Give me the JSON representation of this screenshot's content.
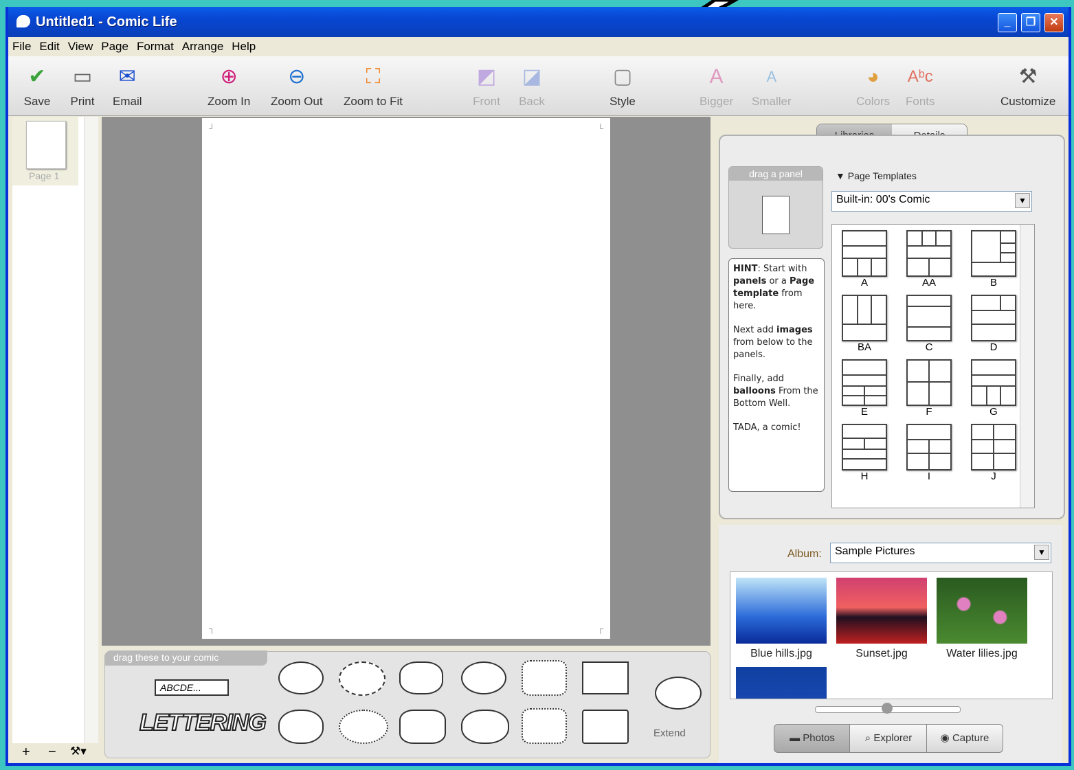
{
  "window": {
    "title": "Untitled1 - Comic Life",
    "controls": [
      "_",
      "❐",
      "✕"
    ]
  },
  "menu": [
    "File",
    "Edit",
    "View",
    "Page",
    "Format",
    "Arrange",
    "Help"
  ],
  "toolbar": {
    "save": "Save",
    "print": "Print",
    "email": "Email",
    "zoom_in": "Zoom In",
    "zoom_out": "Zoom Out",
    "zoom_fit": "Zoom to Fit",
    "front": "Front",
    "back": "Back",
    "style": "Style",
    "bigger": "Bigger",
    "smaller": "Smaller",
    "colors": "Colors",
    "fonts": "Fonts",
    "customize": "Customize"
  },
  "pages": {
    "page1_label": "Page 1"
  },
  "bottom_controls": {
    "add": "+",
    "remove": "−",
    "tools": "⚒▾"
  },
  "well": {
    "tab_label": "drag these to your comic",
    "abc": "ABCDE...",
    "lettering": "LETTERING",
    "extend": "Extend"
  },
  "library": {
    "tab_libraries": "Libraries",
    "tab_details": "Details",
    "drag_panel": "drag a panel",
    "page_templates_header": "Page Templates",
    "template_set": "Built-in: 00's Comic",
    "templates": [
      "A",
      "AA",
      "B",
      "BA",
      "C",
      "D",
      "E",
      "F",
      "G",
      "H",
      "I",
      "J"
    ]
  },
  "hint": {
    "p1_a": "HINT",
    "p1_b": ": Start with ",
    "p1_c": "panels",
    "p1_d": " or a ",
    "p1_e": "Page template",
    "p1_f": " from here.",
    "p2_a": "Next add ",
    "p2_b": "images",
    "p2_c": " from below to the panels.",
    "p3_a": "Finally, add ",
    "p3_b": "balloons",
    "p3_c": " From the Bottom Well.",
    "p4": "TADA, a comic!"
  },
  "photos": {
    "album_label": "Album:",
    "album_value": "Sample Pictures",
    "items": [
      "Blue hills.jpg",
      "Sunset.jpg",
      "Water lilies.jpg"
    ],
    "tab_photos": "Photos",
    "tab_explorer": "Explorer",
    "tab_capture": "Capture"
  },
  "colors": {
    "title_bar": "#0846d2",
    "accent_teal": "#3ec6c0"
  }
}
